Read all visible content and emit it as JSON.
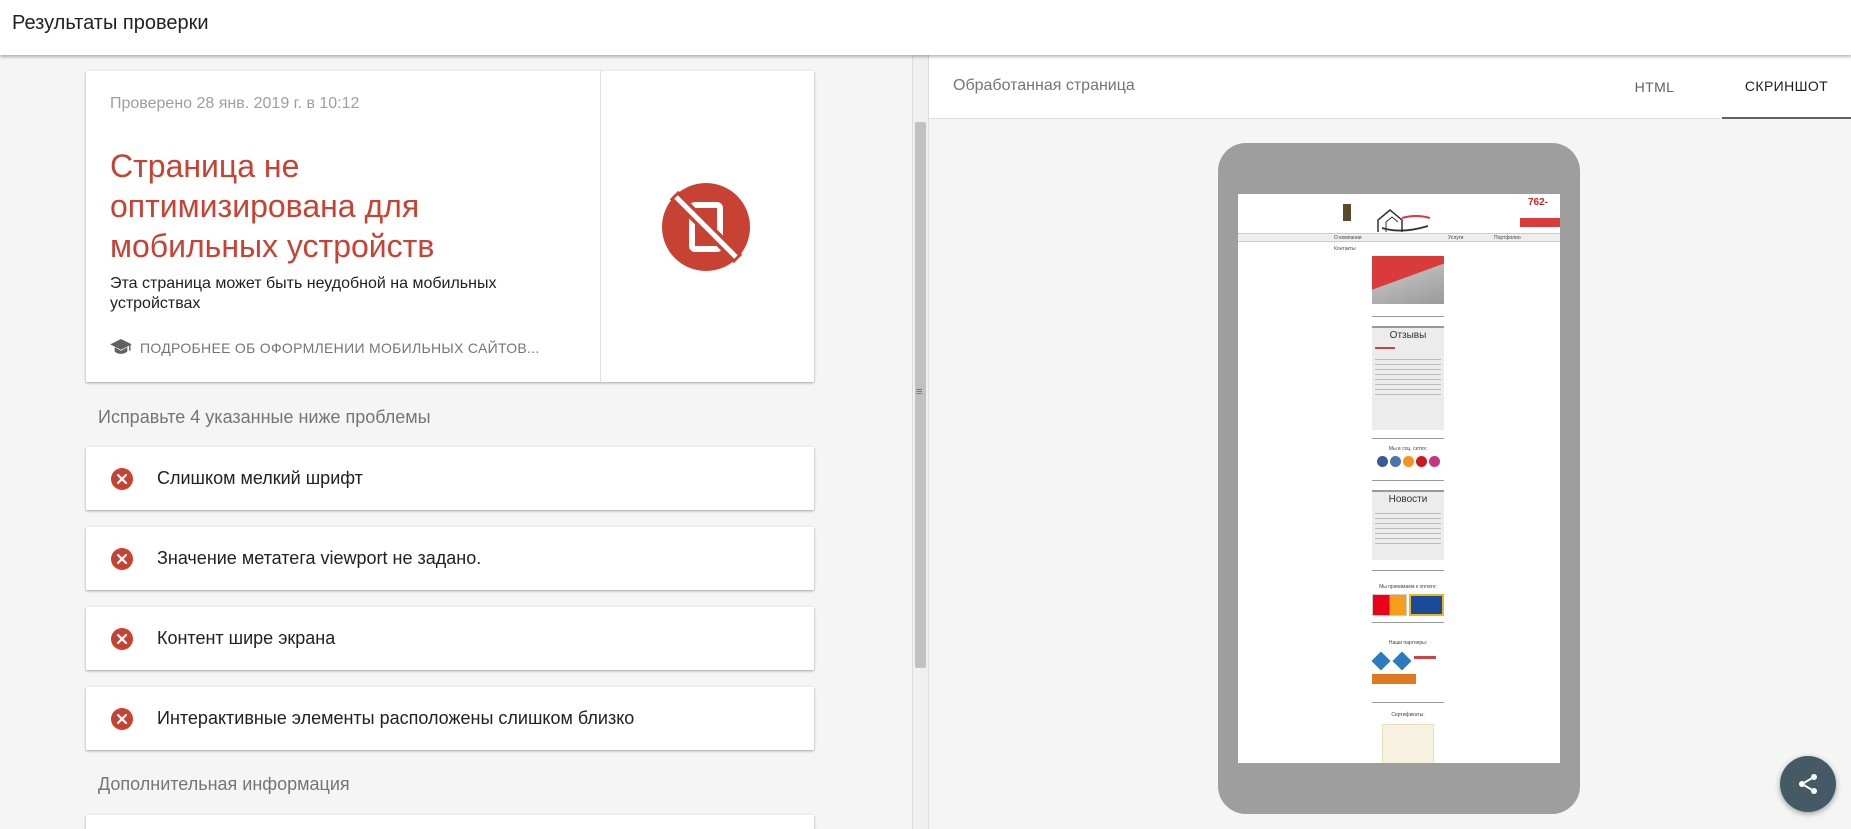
{
  "topbar": {
    "title": "Результаты проверки"
  },
  "summary": {
    "checked": "Проверено 28 янв. 2019 г. в 10:12",
    "headline": "Страница не оптимизирована для мобильных устройств",
    "subtitle": "Эта страница может быть неудобной на мобильных устройствах",
    "learn_more": "ПОДРОБНЕЕ ОБ ОФОРМЛЕНИИ МОБИЛЬНЫХ САЙТОВ..."
  },
  "issues": {
    "heading": "Исправьте 4 указанные ниже проблемы",
    "items": [
      "Слишком мелкий шрифт",
      "Значение метатега viewport не задано.",
      "Контент шире экрана",
      "Интерактивные элементы расположены слишком близко"
    ]
  },
  "additional": {
    "heading": "Дополнительная информация"
  },
  "preview": {
    "label": "Обработанная страница",
    "tab_html": "HTML",
    "tab_screenshot": "СКРИНШОТ",
    "site": {
      "phone": "762-",
      "nav_about": "О компании",
      "nav_services": "Услуги",
      "nav_portfolio": "Портфолио",
      "nav_contacts": "Контакты",
      "reviews": "Отзывы",
      "social": "Мы в соц. сетях:",
      "news": "Новости",
      "payment": "Мы принимаем к оплате:",
      "partners": "Наши партнеры:",
      "certs": "Сертификаты:"
    }
  },
  "colors": {
    "error": "#c74233",
    "share_fab": "#455a64",
    "phone_frame": "#9e9e9e"
  },
  "icons": {
    "learn": "graduation-cap-icon",
    "status": "not-mobile-friendly-icon",
    "issue": "error-circle-icon",
    "share": "share-icon"
  }
}
